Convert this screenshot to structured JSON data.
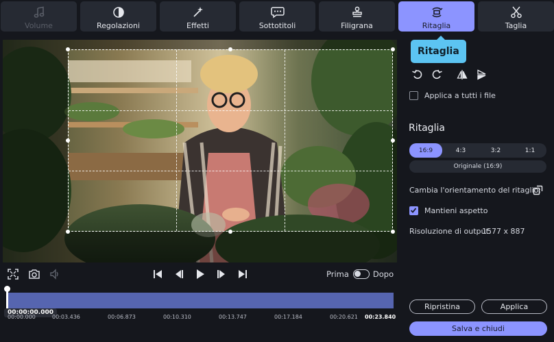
{
  "tabs": [
    {
      "label": "Volume",
      "icon": "music-note-icon",
      "disabled": true
    },
    {
      "label": "Regolazioni",
      "icon": "contrast-icon"
    },
    {
      "label": "Effetti",
      "icon": "magic-wand-icon"
    },
    {
      "label": "Sottotitoli",
      "icon": "speech-bubble-icon"
    },
    {
      "label": "Filigrana",
      "icon": "stamp-icon"
    },
    {
      "label": "Ritaglia",
      "icon": "crop-rotate-icon",
      "active": true
    },
    {
      "label": "Taglia",
      "icon": "scissors-icon"
    }
  ],
  "controls": {
    "before_label": "Prima",
    "after_label": "Dopo"
  },
  "timeline": {
    "current_time": "00:00:00.000",
    "ticks": [
      "00:00.000",
      "00:03.436",
      "00:06.873",
      "00:10.310",
      "00:13.747",
      "00:17.184",
      "00:20.621",
      "00:23.840"
    ]
  },
  "panel": {
    "tooltip": "Ritaglia",
    "apply_all_label": "Applica a tutti i file",
    "crop_title": "Ritaglia",
    "ratios": [
      "16:9",
      "4:3",
      "3:2",
      "1:1"
    ],
    "active_ratio": "16:9",
    "original_label": "Originale (16:9)",
    "orientation_label": "Cambia l'orientamento del ritaglio:",
    "keep_aspect_label": "Mantieni aspetto",
    "resolution_label": "Risoluzione di output:",
    "resolution_value": "1577 x 887",
    "reset_label": "Ripristina",
    "apply_label": "Applica",
    "save_close_label": "Salva e chiudi"
  },
  "colors": {
    "accent": "#8c94ff",
    "tooltip": "#5cc4f2",
    "timeline": "#5665b0",
    "background": "#15171d"
  }
}
